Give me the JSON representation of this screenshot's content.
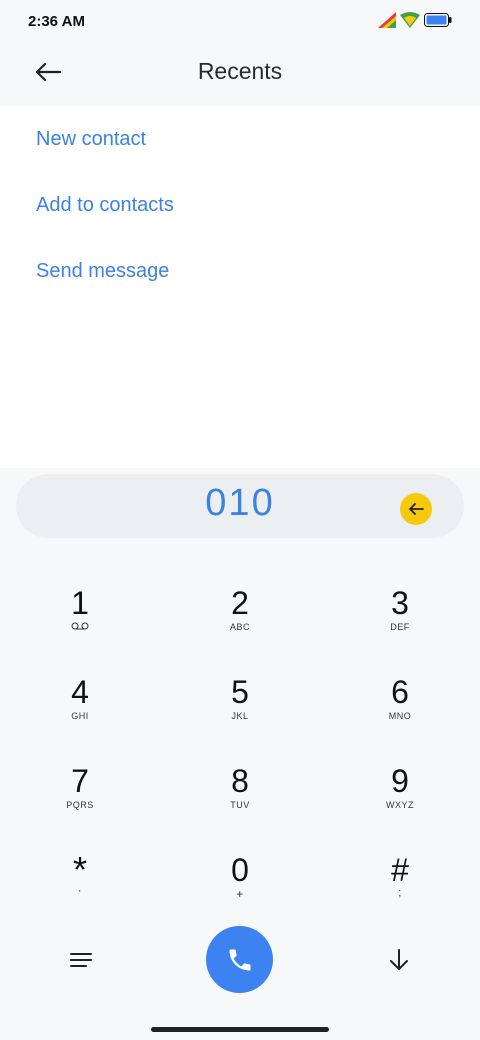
{
  "status_bar": {
    "time": "2:36 AM",
    "icons": [
      "signal-icon",
      "wifi-icon",
      "battery-icon"
    ]
  },
  "header": {
    "title": "Recents",
    "back_icon": "arrow-left-icon"
  },
  "actions": [
    {
      "label": "New contact"
    },
    {
      "label": "Add to contacts"
    },
    {
      "label": "Send message"
    }
  ],
  "dialer": {
    "number": "010",
    "delete_icon": "backspace-icon",
    "keys": [
      {
        "digit": "1",
        "letters": ""
      },
      {
        "digit": "2",
        "letters": "ABC"
      },
      {
        "digit": "3",
        "letters": "DEF"
      },
      {
        "digit": "4",
        "letters": "GHI"
      },
      {
        "digit": "5",
        "letters": "JKL"
      },
      {
        "digit": "6",
        "letters": "MNO"
      },
      {
        "digit": "7",
        "letters": "PQRS"
      },
      {
        "digit": "8",
        "letters": "TUV"
      },
      {
        "digit": "9",
        "letters": "WXYZ"
      },
      {
        "digit": "*",
        "letters": ","
      },
      {
        "digit": "0",
        "letters": "+"
      },
      {
        "digit": "#",
        "letters": ";"
      }
    ]
  },
  "bottom_bar": {
    "menu_icon": "menu-icon",
    "call_icon": "phone-icon",
    "collapse_icon": "arrow-down-icon"
  },
  "colors": {
    "accent": "#3c82e0",
    "call_button": "#3c82f0",
    "delete_button": "#f6c90e",
    "background": "#f7f8fa"
  }
}
